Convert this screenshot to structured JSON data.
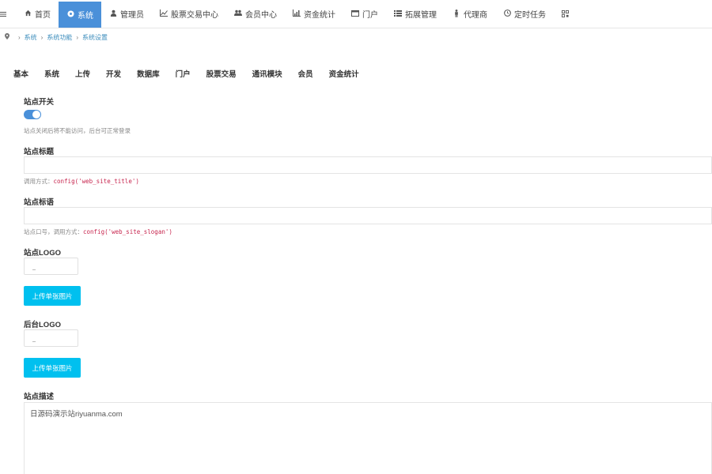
{
  "nav": {
    "toggle_icon": "bars-icon",
    "items": [
      {
        "label": "首页",
        "icon": "home-icon",
        "glyph": "⌂",
        "active": false
      },
      {
        "label": "系统",
        "icon": "gear-circle-icon",
        "glyph": "⚙",
        "active": true
      },
      {
        "label": "管理员",
        "icon": "user-icon",
        "glyph": "👤",
        "active": false
      },
      {
        "label": "股票交易中心",
        "icon": "line-chart-icon",
        "glyph": "📈",
        "active": false
      },
      {
        "label": "会员中心",
        "icon": "users-icon",
        "glyph": "👥",
        "active": false
      },
      {
        "label": "资金统计",
        "icon": "bar-chart-icon",
        "glyph": "📊",
        "active": false
      },
      {
        "label": "门户",
        "icon": "window-icon",
        "glyph": "▭",
        "active": false
      },
      {
        "label": "拓展管理",
        "icon": "list-icon",
        "glyph": "☰",
        "active": false
      },
      {
        "label": "代理商",
        "icon": "person-icon",
        "glyph": "♙",
        "active": false
      },
      {
        "label": "定时任务",
        "icon": "clock-icon",
        "glyph": "◷",
        "active": false
      }
    ],
    "extra_icon": "qrcode-icon"
  },
  "breadcrumb": {
    "items": [
      "系统",
      "系统功能",
      "系统设置"
    ]
  },
  "tabs": [
    "基本",
    "系统",
    "上传",
    "开发",
    "数据库",
    "门户",
    "股票交易",
    "通讯模块",
    "会员",
    "资金统计"
  ],
  "form": {
    "site_switch": {
      "label": "站点开关",
      "help": "站点关闭后将不能访问，后台可正常登录",
      "value": "on"
    },
    "site_title": {
      "label": "站点标题",
      "value": "",
      "help_prefix": "调用方式：",
      "help_code": "config('web_site_title')"
    },
    "site_slogan": {
      "label": "站点标语",
      "value": "",
      "help_prefix": "站点口号，调用方式：",
      "help_code": "config('web_site_slogan')"
    },
    "site_logo": {
      "label": "站点LOGO",
      "button": "上传单张图片"
    },
    "admin_logo": {
      "label": "后台LOGO",
      "button": "上传单张图片"
    },
    "site_description": {
      "label": "站点描述",
      "value": "日源码演示站riyuanma.com"
    }
  },
  "colors": {
    "nav_active": "#4a90d9",
    "upload_button": "#00c0ef",
    "link": "#3c8dbc",
    "code": "#c7254e"
  }
}
